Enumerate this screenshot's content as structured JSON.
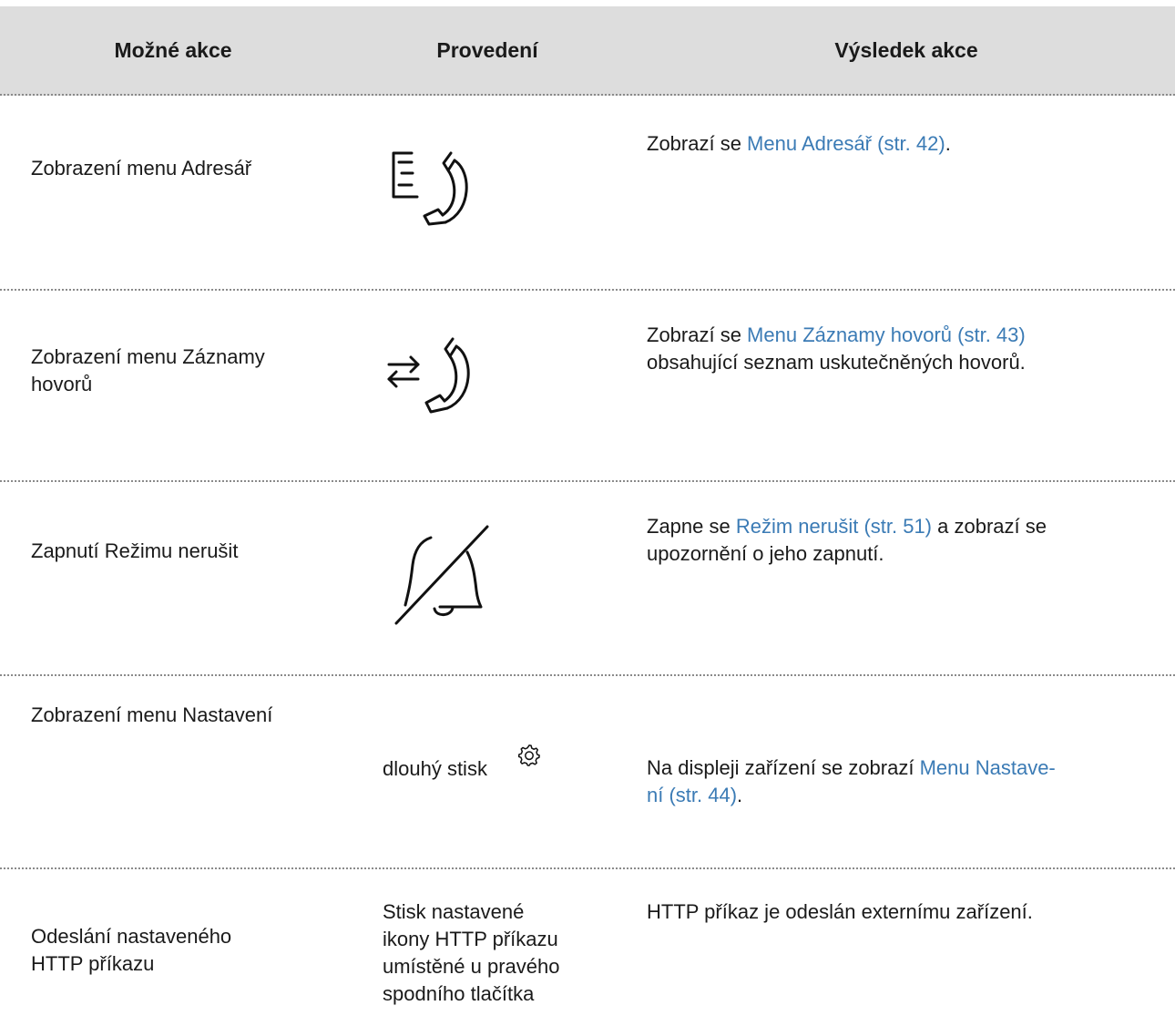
{
  "headers": {
    "actions": "Možné akce",
    "execution": "Provedení",
    "result": "Výsledek akce"
  },
  "rows": [
    {
      "action": "Zobrazení menu Adresář",
      "icon": "phonebook-icon",
      "result_prefix": "Zobrazí se ",
      "result_link": "Menu Adresář (str. 42)",
      "result_suffix": "."
    },
    {
      "action_line1": "Zobrazení menu Záznamy",
      "action_line2": "hovorů",
      "icon": "call-log-icon",
      "result_prefix": "Zobrazí se ",
      "result_link": "Menu Záznamy hovorů (str. 43)",
      "result_line2": "obsahující seznam uskutečněných hovorů."
    },
    {
      "action": "Zapnutí Režimu nerušit",
      "icon": "bell-off-icon",
      "result_prefix": "Zapne se ",
      "result_link": "Režim nerušit (str. 51)",
      "result_suffix": " a zobrazí se",
      "result_line2": "upozornění o jeho zapnutí."
    },
    {
      "action": "Zobrazení menu Nastavení",
      "execution": "dlouhý stisk",
      "icon": "gear-icon",
      "result_line1": "Na displeji zařízení se zobrazí ",
      "result_link1": "Menu Nastave-",
      "result_link2": "ní (str. 44)",
      "result_suffix": "."
    },
    {
      "action_line1": "Odeslání nastaveného",
      "action_line2": "HTTP příkazu",
      "execution_lines": [
        "Stisk nastavené",
        "ikony HTTP příkazu",
        "umístěné u pravého",
        "spodního tlačítka"
      ],
      "result": "HTTP příkaz je odeslán externímu zařízení."
    }
  ]
}
